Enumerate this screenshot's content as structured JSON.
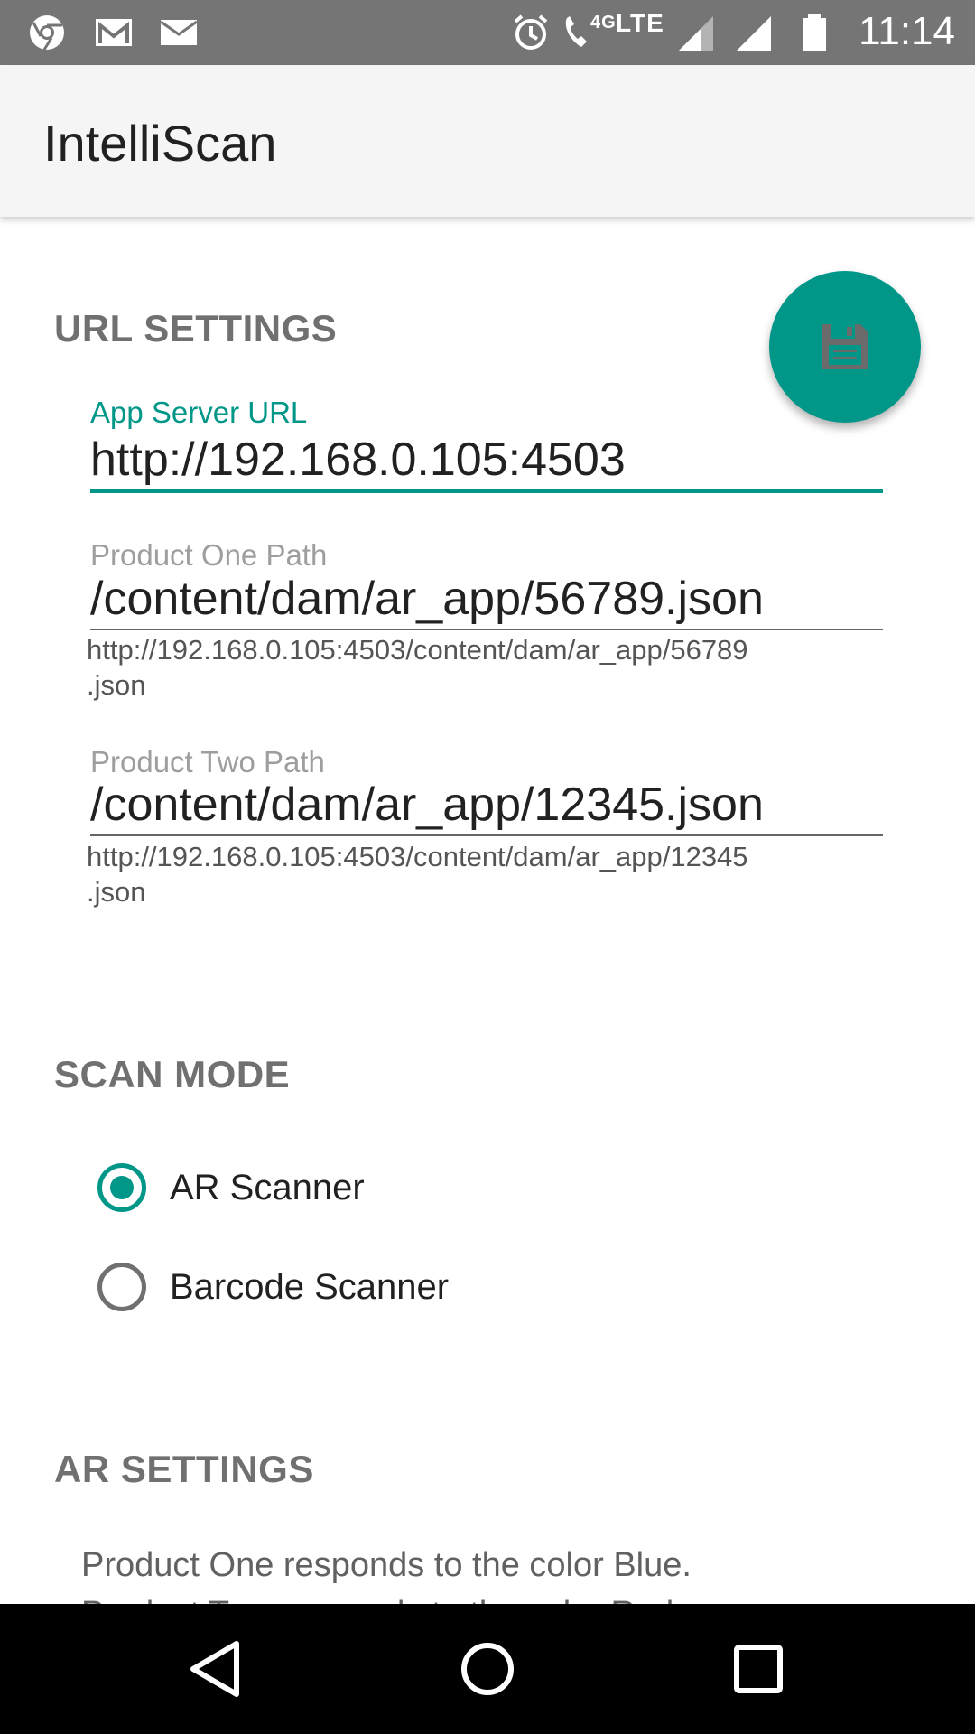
{
  "status_bar": {
    "network": "LTE",
    "network_small": "4G",
    "time": "11:14",
    "icons": [
      "chrome-icon",
      "gmail-icon",
      "email-icon",
      "alarm-icon",
      "wifi-calling-icon",
      "signal-icon",
      "signal-icon",
      "battery-icon"
    ]
  },
  "app_bar": {
    "title": "IntelliScan"
  },
  "fab": {
    "icon": "save-icon",
    "color": "#009688"
  },
  "url_settings": {
    "header": "URL SETTINGS",
    "app_server": {
      "label": "App Server URL",
      "value": "http://192.168.0.105:4503"
    },
    "product_one": {
      "label": "Product One Path",
      "value": "/content/dam/ar_app/56789.json",
      "helper_line1": "http://192.168.0.105:4503/content/dam/ar_app/56789",
      "helper_line2": ".json"
    },
    "product_two": {
      "label": "Product Two Path",
      "value": "/content/dam/ar_app/12345.json",
      "helper_line1": "http://192.168.0.105:4503/content/dam/ar_app/12345",
      "helper_line2": ".json"
    }
  },
  "scan_mode": {
    "header": "SCAN MODE",
    "options": [
      {
        "label": "AR Scanner",
        "checked": true
      },
      {
        "label": "Barcode Scanner",
        "checked": false
      }
    ]
  },
  "ar_settings": {
    "header": "AR SETTINGS",
    "line1": "Product One responds to the color Blue.",
    "line2": "Product Two responds to the color Red."
  },
  "nav_bar": {
    "icons": [
      "back-icon",
      "home-icon",
      "recents-icon"
    ]
  },
  "colors": {
    "accent": "#009688",
    "status_bar": "#757575",
    "app_bar": "#f5f5f5"
  }
}
